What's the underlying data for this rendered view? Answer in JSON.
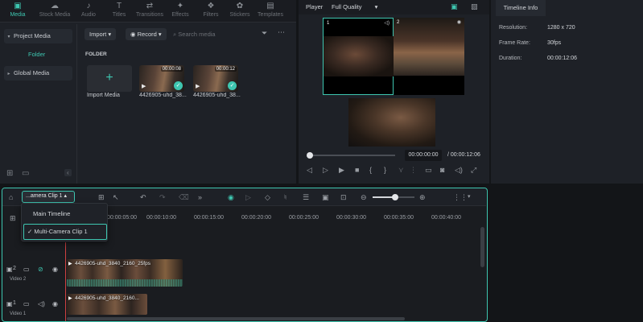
{
  "media_tabs": [
    {
      "label": "Media",
      "icon": "media-icon",
      "glyph": "▣",
      "active": true
    },
    {
      "label": "Stock Media",
      "icon": "stock-media-icon",
      "glyph": "☁",
      "active": false
    },
    {
      "label": "Audio",
      "icon": "audio-icon",
      "glyph": "♪",
      "active": false
    },
    {
      "label": "Titles",
      "icon": "titles-icon",
      "glyph": "T",
      "active": false
    },
    {
      "label": "Transitions",
      "icon": "transitions-icon",
      "glyph": "⇄",
      "active": false
    },
    {
      "label": "Effects",
      "icon": "effects-icon",
      "glyph": "✦",
      "active": false
    },
    {
      "label": "Filters",
      "icon": "filters-icon",
      "glyph": "❖",
      "active": false
    },
    {
      "label": "Stickers",
      "icon": "stickers-icon",
      "glyph": "✿",
      "active": false
    },
    {
      "label": "Templates",
      "icon": "templates-icon",
      "glyph": "▤",
      "active": false
    }
  ],
  "sidebar": {
    "project_media": "Project Media",
    "folder": "Folder",
    "global_media": "Global Media"
  },
  "media_toolbar": {
    "import_label": "Import",
    "record_label": "Record",
    "search_placeholder": "Search media"
  },
  "media_grid": {
    "folder_heading": "FOLDER",
    "import_label": "Import Media",
    "clips": [
      {
        "name": "4426905-uhd_38...",
        "duration": "00:00:08"
      },
      {
        "name": "4426905-uhd_38...",
        "duration": "00:00:12"
      }
    ]
  },
  "player": {
    "label": "Player",
    "quality": "Full Quality",
    "cam1_number": "1",
    "cam2_number": "2",
    "current_time": "00:00:00:00",
    "total_time": "/ 00:00:12:06",
    "progress": 0
  },
  "info_panel": {
    "tab": "Timeline Info",
    "rows": [
      {
        "key": "Resolution:",
        "value": "1280 x 720"
      },
      {
        "key": "Frame Rate:",
        "value": "30fps"
      },
      {
        "key": "Duration:",
        "value": "00:00:12:06"
      }
    ]
  },
  "timeline": {
    "clip_selector": "...amera Clip 1",
    "zoom_level": 0.5,
    "ruler_ticks": [
      "00:00:05:00",
      "00:00:10:00",
      "00:00:15:00",
      "00:00:20:00",
      "00:00:25:00",
      "00:00:30:00",
      "00:00:35:00",
      "00:00:40:00"
    ],
    "dropdown": {
      "main_timeline": "Main Timeline",
      "multi_camera": "Multi-Camera Clip 1",
      "check": "✓"
    },
    "tracks": [
      {
        "label": "Video 2",
        "number": "2",
        "clip_title": "4426905-uhd_3840_2160_25fps"
      },
      {
        "label": "Video 1",
        "number": "1",
        "clip_title": "4426905-uhd_3840_2160..."
      }
    ]
  },
  "colors": {
    "accent": "#3ec6b0",
    "background": "#1e2127",
    "playhead": "#d04040"
  }
}
